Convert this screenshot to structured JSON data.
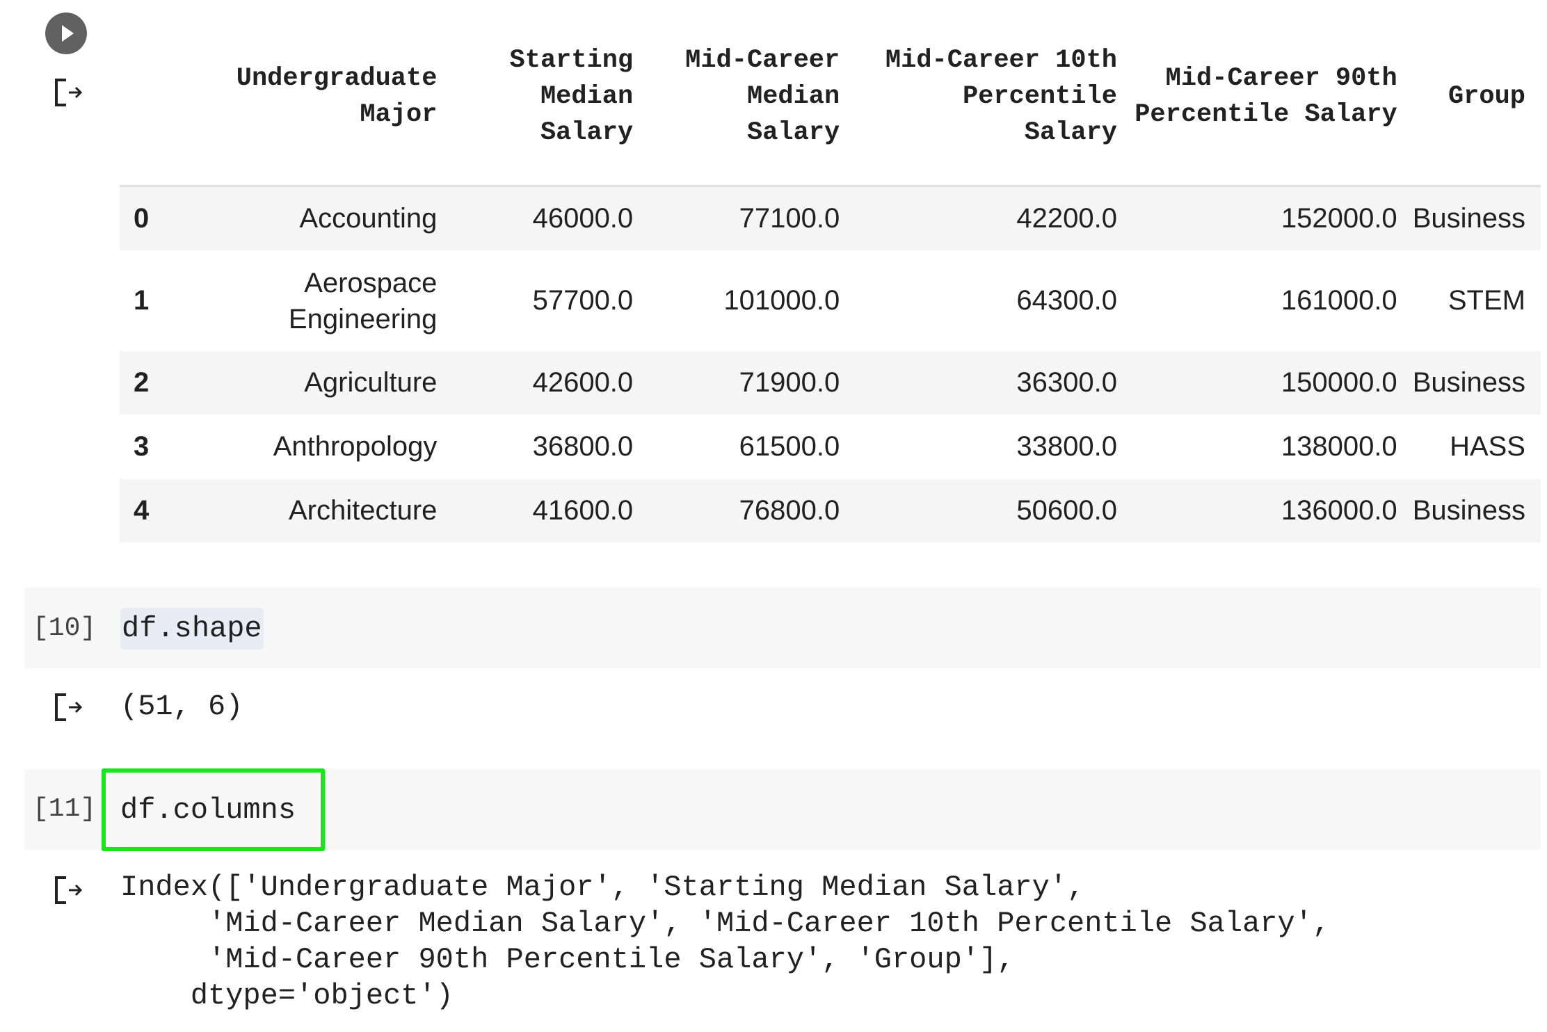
{
  "table": {
    "columns": [
      "",
      "Undergraduate Major",
      "Starting Median Salary",
      "Mid-Career Median Salary",
      "Mid-Career 10th Percentile Salary",
      "Mid-Career 90th Percentile Salary",
      "Group"
    ],
    "rows": [
      [
        "0",
        "Accounting",
        "46000.0",
        "77100.0",
        "42200.0",
        "152000.0",
        "Business"
      ],
      [
        "1",
        "Aerospace Engineering",
        "57700.0",
        "101000.0",
        "64300.0",
        "161000.0",
        "STEM"
      ],
      [
        "2",
        "Agriculture",
        "42600.0",
        "71900.0",
        "36300.0",
        "150000.0",
        "Business"
      ],
      [
        "3",
        "Anthropology",
        "36800.0",
        "61500.0",
        "33800.0",
        "138000.0",
        "HASS"
      ],
      [
        "4",
        "Architecture",
        "41600.0",
        "76800.0",
        "50600.0",
        "136000.0",
        "Business"
      ]
    ]
  },
  "cells": [
    {
      "prompt": "[10]",
      "code": "df.shape",
      "output": "(51, 6)"
    },
    {
      "prompt": "[11]",
      "code": "df.columns",
      "output": "Index(['Undergraduate Major', 'Starting Median Salary',\n     'Mid-Career Median Salary', 'Mid-Career 10th Percentile Salary',\n     'Mid-Career 90th Percentile Salary', 'Group'],\n    dtype='object')"
    }
  ],
  "highlight_color": "#19e619"
}
